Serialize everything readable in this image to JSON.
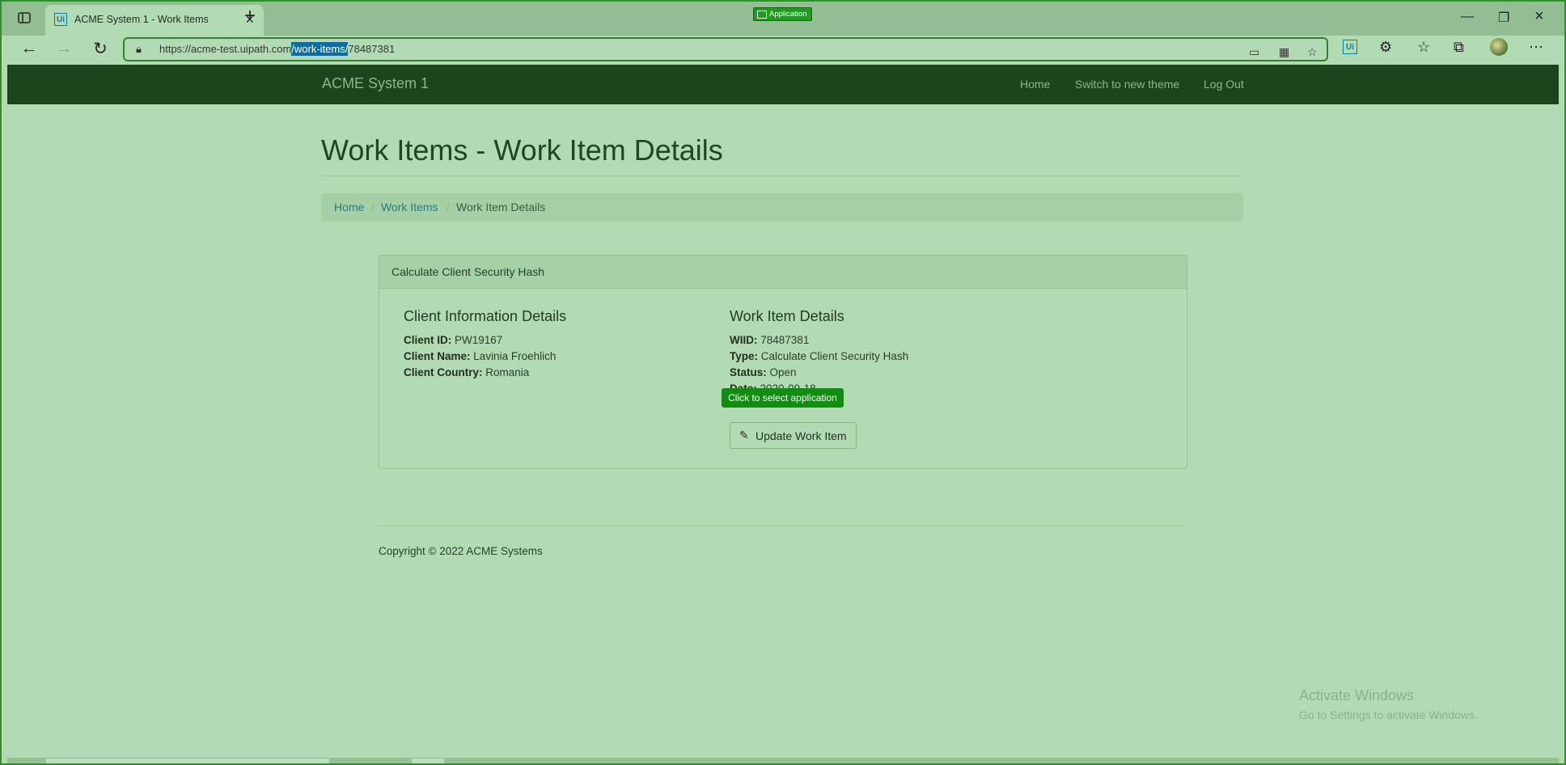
{
  "browser": {
    "tab_title": "ACME System 1 - Work Items",
    "tab_favicon": "Ui",
    "app_badge": "Application",
    "url_prefix": "https://acme-test.uipath.com",
    "url_selected": "/work-items/",
    "url_suffix": "78487381",
    "toolbar_ui_icon": "Ui"
  },
  "navbar": {
    "brand": "ACME System 1",
    "links": [
      "Home",
      "Switch to new theme",
      "Log Out"
    ]
  },
  "page": {
    "title": "Work Items - Work Item Details",
    "breadcrumb": [
      "Home",
      "Work Items",
      "Work Item Details"
    ],
    "breadcrumb_sep": "/"
  },
  "panel": {
    "heading": "Calculate Client Security Hash",
    "client": {
      "title": "Client Information Details",
      "id_label": "Client ID:",
      "id_value": "PW19167",
      "name_label": "Client Name:",
      "name_value": "Lavinia Froehlich",
      "country_label": "Client Country:",
      "country_value": "Romania"
    },
    "work_item": {
      "title": "Work Item Details",
      "wiid_label": "WIID:",
      "wiid_value": "78487381",
      "type_label": "Type:",
      "type_value": "Calculate Client Security Hash",
      "status_label": "Status:",
      "status_value": "Open",
      "date_label": "Date:",
      "date_value": "2020-09-18"
    },
    "update_button": "Update Work Item"
  },
  "tooltip": "Click to select application",
  "footer": {
    "copyright": "Copyright © 2022 ACME Systems"
  },
  "watermark": {
    "line1": "Activate Windows",
    "line2": "Go to Settings to activate Windows."
  },
  "colors": {
    "accent": "#128c12",
    "navbar": "#1b451b",
    "page_bg": "#b3dbb3",
    "link": "#2b7b86"
  }
}
